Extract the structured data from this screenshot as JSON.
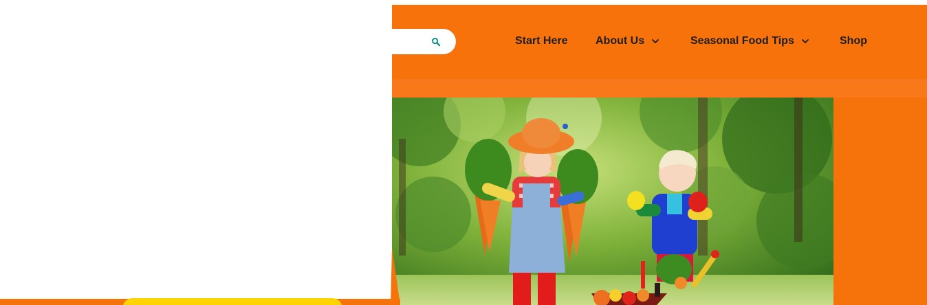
{
  "header": {
    "nav": [
      {
        "label": "Start Here",
        "has_dropdown": false
      },
      {
        "label": "About Us",
        "has_dropdown": true
      },
      {
        "label": "Seasonal Food Tips",
        "has_dropdown": true
      },
      {
        "label": "Shop",
        "has_dropdown": false
      }
    ],
    "search_icon": "search-icon",
    "dropdown_icon": "chevron-down-icon"
  },
  "hero": {
    "image": "children-holding-carrots-and-peppers-in-garden"
  },
  "colors": {
    "brand_orange": "#f7720a",
    "accent_yellow": "#ffd400",
    "search_icon": "#15918a",
    "nav_text": "#1e1e1e"
  }
}
